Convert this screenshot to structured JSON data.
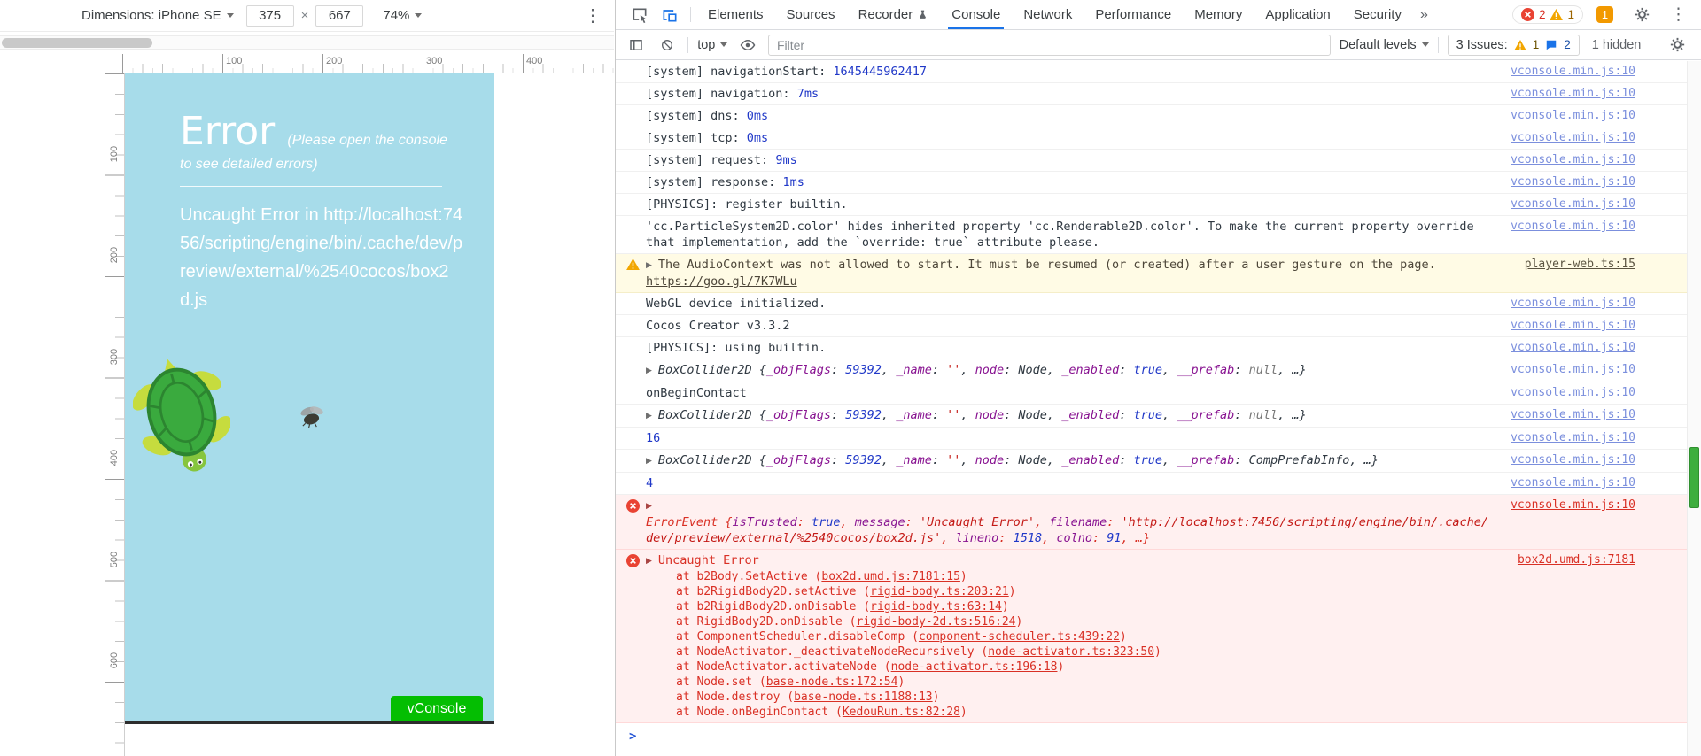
{
  "icons": {
    "more": "⋮",
    "gear": "⚙"
  },
  "colors": {
    "canvas_bg": "#a7dcea",
    "vconsole_green": "#04be02",
    "accent_blue": "#1a73e8",
    "error_red": "#d93025",
    "warn_yellow": "#f2a600"
  },
  "device_toolbar": {
    "dimensions": "Dimensions: iPhone SE",
    "width": "375",
    "multiply": "×",
    "height": "667",
    "zoom": "74%"
  },
  "rulers": {
    "horizontal": [
      "100",
      "200",
      "300",
      "400"
    ],
    "vertical": [
      "100",
      "200",
      "300",
      "400",
      "500",
      "600"
    ]
  },
  "preview": {
    "title": "Error",
    "subtitle": "(Please open the console to see detailed errors)",
    "message": "Uncaught Error in http://localhost:7456/scripting/engine/bin/.cache/dev/preview/external/%2540cocos/box2d.js",
    "vconsole": "vConsole"
  },
  "devtools": {
    "tabs": [
      "Elements",
      "Sources",
      "Recorder",
      "Console",
      "Network",
      "Performance",
      "Memory",
      "Application",
      "Security"
    ],
    "active_tab": "Console",
    "more_tabs": "»",
    "error_count": "2",
    "warning_count": "1",
    "issue_badge": "1"
  },
  "console_toolbar": {
    "context": "top",
    "filter_placeholder": "Filter",
    "levels": "Default levels",
    "issues": "3 Issues:",
    "issues_warn": "1",
    "issues_msg": "2",
    "hidden": "1 hidden"
  },
  "console": {
    "prompt": ">",
    "messages": [
      {
        "parts": [
          {
            "c": "t",
            "v": "[system] navigationStart: "
          },
          {
            "c": "n",
            "v": "1645445962417"
          }
        ],
        "link": "vconsole.min.js:10"
      },
      {
        "parts": [
          {
            "c": "t",
            "v": "[system] navigation: "
          },
          {
            "c": "n",
            "v": "7ms"
          }
        ],
        "link": "vconsole.min.js:10"
      },
      {
        "parts": [
          {
            "c": "t",
            "v": "[system] dns: "
          },
          {
            "c": "n",
            "v": "0ms"
          }
        ],
        "link": "vconsole.min.js:10"
      },
      {
        "parts": [
          {
            "c": "t",
            "v": "[system] tcp: "
          },
          {
            "c": "n",
            "v": "0ms"
          }
        ],
        "link": "vconsole.min.js:10"
      },
      {
        "parts": [
          {
            "c": "t",
            "v": "[system] request: "
          },
          {
            "c": "n",
            "v": "9ms"
          }
        ],
        "link": "vconsole.min.js:10"
      },
      {
        "parts": [
          {
            "c": "t",
            "v": "[system] response: "
          },
          {
            "c": "n",
            "v": "1ms"
          }
        ],
        "link": "vconsole.min.js:10"
      },
      {
        "parts": [
          {
            "c": "t",
            "v": "[PHYSICS]: register builtin."
          }
        ],
        "link": "vconsole.min.js:10"
      },
      {
        "parts": [
          {
            "c": "t",
            "v": "'cc.ParticleSystem2D.color' hides inherited property 'cc.Renderable2D.color'. To make the current property override that implementation, add the `override: true` attribute please."
          }
        ],
        "link": "vconsole.min.js:10"
      },
      {
        "type": "warn",
        "arrow": true,
        "parts": [
          {
            "c": "t",
            "v": "The AudioContext was not allowed to start. It must be resumed (or created) after a user gesture on the page. "
          },
          {
            "c": "u",
            "v": "https://goo.gl/7K7WLu"
          }
        ],
        "link": "player-web.ts:15"
      },
      {
        "parts": [
          {
            "c": "t",
            "v": "WebGL device initialized."
          }
        ],
        "link": "vconsole.min.js:10"
      },
      {
        "parts": [
          {
            "c": "t",
            "v": "Cocos Creator v3.3.2"
          }
        ],
        "link": "vconsole.min.js:10"
      },
      {
        "parts": [
          {
            "c": "t",
            "v": "[PHYSICS]: using builtin."
          }
        ],
        "link": "vconsole.min.js:10"
      },
      {
        "arrow": true,
        "italic": true,
        "parts": [
          {
            "c": "i",
            "v": "BoxCollider2D"
          },
          {
            "c": "t",
            "v": " {"
          },
          {
            "c": "p",
            "v": "_objFlags"
          },
          {
            "c": "t",
            "v": ": "
          },
          {
            "c": "n",
            "v": "59392"
          },
          {
            "c": "t",
            "v": ", "
          },
          {
            "c": "p",
            "v": "_name"
          },
          {
            "c": "t",
            "v": ": "
          },
          {
            "c": "s",
            "v": "''"
          },
          {
            "c": "t",
            "v": ", "
          },
          {
            "c": "p",
            "v": "node"
          },
          {
            "c": "t",
            "v": ": "
          },
          {
            "c": "t",
            "v": "Node"
          },
          {
            "c": "t",
            "v": ", "
          },
          {
            "c": "p",
            "v": "_enabled"
          },
          {
            "c": "t",
            "v": ": "
          },
          {
            "c": "n",
            "v": "true"
          },
          {
            "c": "t",
            "v": ", "
          },
          {
            "c": "p",
            "v": "__prefab"
          },
          {
            "c": "t",
            "v": ": "
          },
          {
            "c": "g",
            "v": "null"
          },
          {
            "c": "t",
            "v": ", …}"
          }
        ],
        "link": "vconsole.min.js:10"
      },
      {
        "parts": [
          {
            "c": "t",
            "v": "onBeginContact"
          }
        ],
        "link": "vconsole.min.js:10"
      },
      {
        "arrow": true,
        "italic": true,
        "parts": [
          {
            "c": "i",
            "v": "BoxCollider2D"
          },
          {
            "c": "t",
            "v": " {"
          },
          {
            "c": "p",
            "v": "_objFlags"
          },
          {
            "c": "t",
            "v": ": "
          },
          {
            "c": "n",
            "v": "59392"
          },
          {
            "c": "t",
            "v": ", "
          },
          {
            "c": "p",
            "v": "_name"
          },
          {
            "c": "t",
            "v": ": "
          },
          {
            "c": "s",
            "v": "''"
          },
          {
            "c": "t",
            "v": ", "
          },
          {
            "c": "p",
            "v": "node"
          },
          {
            "c": "t",
            "v": ": "
          },
          {
            "c": "t",
            "v": "Node"
          },
          {
            "c": "t",
            "v": ", "
          },
          {
            "c": "p",
            "v": "_enabled"
          },
          {
            "c": "t",
            "v": ": "
          },
          {
            "c": "n",
            "v": "true"
          },
          {
            "c": "t",
            "v": ", "
          },
          {
            "c": "p",
            "v": "__prefab"
          },
          {
            "c": "t",
            "v": ": "
          },
          {
            "c": "g",
            "v": "null"
          },
          {
            "c": "t",
            "v": ", …}"
          }
        ],
        "link": "vconsole.min.js:10"
      },
      {
        "parts": [
          {
            "c": "n",
            "v": "16"
          }
        ],
        "link": "vconsole.min.js:10"
      },
      {
        "arrow": true,
        "italic": true,
        "parts": [
          {
            "c": "i",
            "v": "BoxCollider2D"
          },
          {
            "c": "t",
            "v": " {"
          },
          {
            "c": "p",
            "v": "_objFlags"
          },
          {
            "c": "t",
            "v": ": "
          },
          {
            "c": "n",
            "v": "59392"
          },
          {
            "c": "t",
            "v": ", "
          },
          {
            "c": "p",
            "v": "_name"
          },
          {
            "c": "t",
            "v": ": "
          },
          {
            "c": "s",
            "v": "''"
          },
          {
            "c": "t",
            "v": ", "
          },
          {
            "c": "p",
            "v": "node"
          },
          {
            "c": "t",
            "v": ": "
          },
          {
            "c": "t",
            "v": "Node"
          },
          {
            "c": "t",
            "v": ", "
          },
          {
            "c": "p",
            "v": "_enabled"
          },
          {
            "c": "t",
            "v": ": "
          },
          {
            "c": "n",
            "v": "true"
          },
          {
            "c": "t",
            "v": ", "
          },
          {
            "c": "p",
            "v": "__prefab"
          },
          {
            "c": "t",
            "v": ": "
          },
          {
            "c": "t",
            "v": "CompPrefabInfo"
          },
          {
            "c": "t",
            "v": ", …}"
          }
        ],
        "link": "vconsole.min.js:10"
      },
      {
        "parts": [
          {
            "c": "n",
            "v": "4"
          }
        ],
        "link": "vconsole.min.js:10"
      },
      {
        "type": "error",
        "arrow": true,
        "block": [
          [
            {
              "c": "i",
              "v": "ErrorEvent"
            },
            {
              "c": "t",
              "v": " {"
            },
            {
              "c": "p",
              "v": "isTrusted"
            },
            {
              "c": "t",
              "v": ": "
            },
            {
              "c": "n",
              "v": "true"
            },
            {
              "c": "t",
              "v": ", "
            },
            {
              "c": "p",
              "v": "message"
            },
            {
              "c": "t",
              "v": ": "
            },
            {
              "c": "s",
              "v": "'Uncaught Error'"
            },
            {
              "c": "t",
              "v": ", "
            },
            {
              "c": "p",
              "v": "filename"
            },
            {
              "c": "t",
              "v": ": "
            },
            {
              "c": "s",
              "v": "'http://localhost:7456/scripting/engine/bin/.cache/dev/preview/external/%2540cocos/box2d.js'"
            },
            {
              "c": "t",
              "v": ", "
            },
            {
              "c": "p",
              "v": "lineno"
            },
            {
              "c": "t",
              "v": ": "
            },
            {
              "c": "n",
              "v": "1518"
            },
            {
              "c": "t",
              "v": ", "
            },
            {
              "c": "p",
              "v": "colno"
            },
            {
              "c": "t",
              "v": ": "
            },
            {
              "c": "n",
              "v": "91"
            },
            {
              "c": "t",
              "v": ", …}"
            }
          ]
        ],
        "link": "vconsole.min.js:10"
      },
      {
        "type": "error",
        "arrow": true,
        "parts": [
          {
            "c": "t",
            "v": "Uncaught Error"
          }
        ],
        "link": "box2d.umd.js:7181",
        "stack": [
          {
            "fn": "b2Body.SetActive",
            "loc": "box2d.umd.js:7181:15"
          },
          {
            "fn": "b2RigidBody2D.setActive",
            "loc": "rigid-body.ts:203:21"
          },
          {
            "fn": "b2RigidBody2D.onDisable",
            "loc": "rigid-body.ts:63:14"
          },
          {
            "fn": "RigidBody2D.onDisable",
            "loc": "rigid-body-2d.ts:516:24"
          },
          {
            "fn": "ComponentScheduler.disableComp",
            "loc": "component-scheduler.ts:439:22"
          },
          {
            "fn": "NodeActivator._deactivateNodeRecursively",
            "loc": "node-activator.ts:323:50"
          },
          {
            "fn": "NodeActivator.activateNode",
            "loc": "node-activator.ts:196:18"
          },
          {
            "fn": "Node.set",
            "loc": "base-node.ts:172:54"
          },
          {
            "fn": "Node.destroy",
            "loc": "base-node.ts:1188:13"
          },
          {
            "fn": "Node.onBeginContact",
            "loc": "KedouRun.ts:82:28"
          }
        ]
      }
    ]
  }
}
